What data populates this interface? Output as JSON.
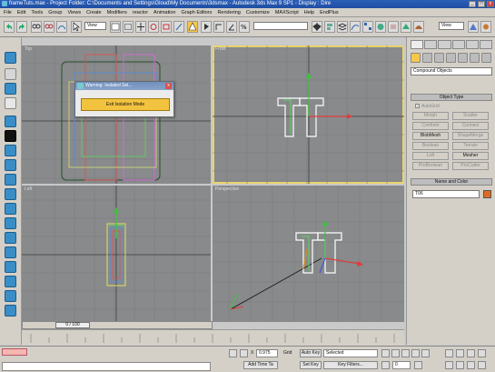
{
  "window": {
    "title": "frameTuts.max   -   Project Folder: C:\\Documents and Settings\\Gloud\\My Documents\\3dsmax   -   Autodesk 3ds Max 9 SP1   -   Display : Dire",
    "min": "_",
    "max": "□",
    "close": "x"
  },
  "menu": {
    "items": [
      "File",
      "Edit",
      "Tools",
      "Group",
      "Views",
      "Create",
      "Modifiers",
      "reactor",
      "Animation",
      "Graph Editors",
      "Rendering",
      "Customize",
      "MAXScript",
      "Help",
      "EndPlus"
    ]
  },
  "toolbar": {
    "selection_filter": "View",
    "named_selection": "",
    "right_dropdown": "View"
  },
  "viewports": {
    "top": "Top",
    "front": "Front",
    "left": "Left",
    "perspective": "Perspective"
  },
  "dialog": {
    "title": "Warning: Isolated Sel...",
    "close": "x",
    "button": "Exit Isolation Mode"
  },
  "command_panel": {
    "category": "Compound Objects",
    "object_type_header": "Object Type",
    "autogrid": "AutoGrid",
    "buttons": [
      {
        "label": "Morph",
        "enabled": false
      },
      {
        "label": "Scatter",
        "enabled": false
      },
      {
        "label": "Conform",
        "enabled": false
      },
      {
        "label": "Connect",
        "enabled": false
      },
      {
        "label": "BlobMesh",
        "enabled": true
      },
      {
        "label": "ShapeMerge",
        "enabled": false
      },
      {
        "label": "Boolean",
        "enabled": false
      },
      {
        "label": "Terrain",
        "enabled": false
      },
      {
        "label": "Loft",
        "enabled": false
      },
      {
        "label": "Mesher",
        "enabled": true
      },
      {
        "label": "ProBoolean",
        "enabled": false
      },
      {
        "label": "ProCutter",
        "enabled": false
      }
    ],
    "name_color_header": "Name and Color",
    "name_value": "T06",
    "color": "#e06a22"
  },
  "timeline": {
    "frame_label": "0 / 100"
  },
  "status": {
    "x_value": "0.975",
    "grid_label": "Grid",
    "auto_key": "Auto Key",
    "selected": "Selected",
    "set_key": "Set Key",
    "key_filters": "Key Filters...",
    "add_time_tag": "Add Time Ta",
    "frame": "0"
  }
}
